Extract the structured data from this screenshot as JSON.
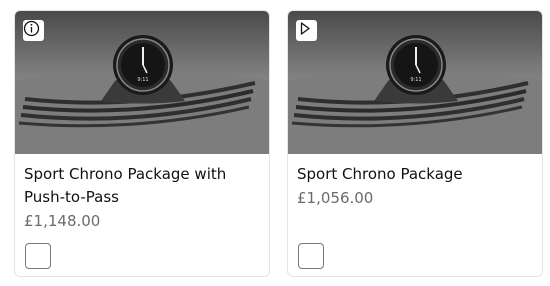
{
  "options": [
    {
      "title": "Sport Chrono Package with Push-to-Pass",
      "price": "£1,148.00",
      "badge_icon": "info-icon",
      "selected": false
    },
    {
      "title": "Sport Chrono Package",
      "price": "£1,056.00",
      "badge_icon": "play-icon",
      "selected": false
    }
  ],
  "clock_text": "9:11"
}
